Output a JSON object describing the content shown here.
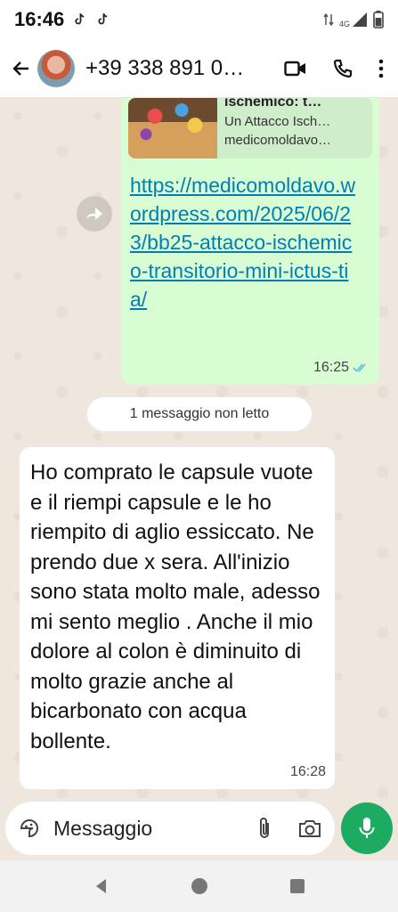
{
  "status_bar": {
    "time": "16:46",
    "network": "4G"
  },
  "header": {
    "contact_name": "+39 338 891 0…",
    "icons": [
      "back-arrow-icon",
      "video-call-icon",
      "voice-call-icon",
      "more-options-icon"
    ]
  },
  "outgoing_message": {
    "preview": {
      "title": "ischemico: t…",
      "description": "Un Attacco Isch…",
      "domain": "medicomoldavo…"
    },
    "link": "https://medicomoldavo.wordpress.com/2025/06/23/bb25-attacco-ischemico-transitorio-mini-ictus-tia/",
    "time": "16:25",
    "status_icon": "double-check-read-icon"
  },
  "unread_divider": "1 messaggio non letto",
  "incoming_message": {
    "text": "Ho comprato le capsule vuote e il riempi capsule e le ho riempito di aglio essiccato. Ne prendo due x sera. All'inizio sono stata molto male, adesso mi sento meglio . Anche il mio dolore al colon è diminuito di molto grazie anche al bicarbonato con acqua bollente.",
    "time": "16:28"
  },
  "composer": {
    "placeholder": "Messaggio",
    "icons": [
      "sticker-icon",
      "attach-icon",
      "camera-icon",
      "mic-icon"
    ]
  },
  "colors": {
    "outgoing_bubble": "#d9fdd3",
    "incoming_bubble": "#ffffff",
    "accent_green": "#1daa61",
    "link": "#027eb5",
    "read_tick": "#53bdeb"
  }
}
